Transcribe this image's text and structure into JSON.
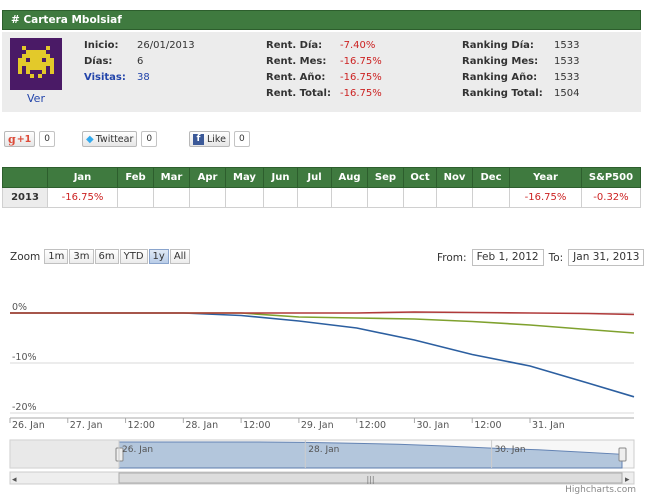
{
  "header": {
    "title": "# Cartera Mbolsiaf"
  },
  "profile": {
    "avatar_icon": "space-invader-icon",
    "ver_label": "Ver",
    "inicio_label": "Inicio:",
    "inicio_value": "26/01/2013",
    "dias_label": "Días:",
    "dias_value": "6",
    "visitas_label": "Visitas:",
    "visitas_value": "38"
  },
  "rentabilidad": {
    "dia_label": "Rent. Día:",
    "dia_value": "-7.40%",
    "mes_label": "Rent. Mes:",
    "mes_value": "-16.75%",
    "ano_label": "Rent. Año:",
    "ano_value": "-16.75%",
    "total_label": "Rent. Total:",
    "total_value": "-16.75%"
  },
  "ranking": {
    "dia_label": "Ranking Día:",
    "dia_value": "1533",
    "mes_label": "Ranking Mes:",
    "mes_value": "1533",
    "ano_label": "Ranking Año:",
    "ano_value": "1533",
    "total_label": "Ranking Total:",
    "total_value": "1504"
  },
  "social": {
    "gplus_label": "+1",
    "gplus_count": "0",
    "twitter_label": "Twittear",
    "twitter_count": "0",
    "like_label": "Like",
    "like_count": "0"
  },
  "monthly_table": {
    "headers": [
      "",
      "Jan",
      "Feb",
      "Mar",
      "Apr",
      "May",
      "Jun",
      "Jul",
      "Aug",
      "Sep",
      "Oct",
      "Nov",
      "Dec",
      "Year",
      "S&P500"
    ],
    "row": [
      "2013",
      "-16.75%",
      "",
      "",
      "",
      "",
      "",
      "",
      "",
      "",
      "",
      "",
      "",
      "-16.75%",
      "-0.32%"
    ]
  },
  "zoom": {
    "label": "Zoom",
    "buttons": [
      "1m",
      "3m",
      "6m",
      "YTD",
      "1y",
      "All"
    ],
    "active": "1y"
  },
  "range": {
    "from_label": "From:",
    "from_value": "Feb 1, 2012",
    "to_label": "To:",
    "to_value": "Jan 31, 2013"
  },
  "chart_data": {
    "type": "line",
    "title": "",
    "xlabel": "",
    "ylabel": "",
    "ylim": [
      -21,
      1
    ],
    "y_ticks": [
      "0%",
      "-10%",
      "-20%"
    ],
    "x_tick_labels": [
      "26. Jan",
      "27. Jan",
      "12:00",
      "28. Jan",
      "12:00",
      "29. Jan",
      "12:00",
      "30. Jan",
      "12:00",
      "31. Jan"
    ],
    "x": [
      0,
      0.5,
      1,
      1.5,
      2,
      2.5,
      3,
      3.5,
      4,
      4.5,
      5,
      5.4
    ],
    "series": [
      {
        "color": "#2c5fa0",
        "values": [
          0,
          0,
          0,
          0,
          -0.5,
          -1.6,
          -3.0,
          -5.4,
          -8.3,
          -10.6,
          -14.0,
          -16.75
        ]
      },
      {
        "color": "#7fa12e",
        "values": [
          0,
          0,
          0,
          0,
          0,
          -0.8,
          -1.0,
          -1.2,
          -1.7,
          -2.4,
          -3.3,
          -4.0
        ]
      },
      {
        "color": "#b03a3a",
        "values": [
          0,
          0,
          0,
          0,
          0,
          0,
          0,
          0.2,
          0.1,
          0,
          -0.1,
          -0.3
        ]
      }
    ],
    "navigator_tick_labels": [
      "26. Jan",
      "28. Jan",
      "30. Jan"
    ],
    "grid": true,
    "credit": "Highcharts.com"
  },
  "colors": {
    "header_green": "#3f7a3f",
    "negative_red": "#cc2222",
    "link_blue": "#2244aa"
  }
}
